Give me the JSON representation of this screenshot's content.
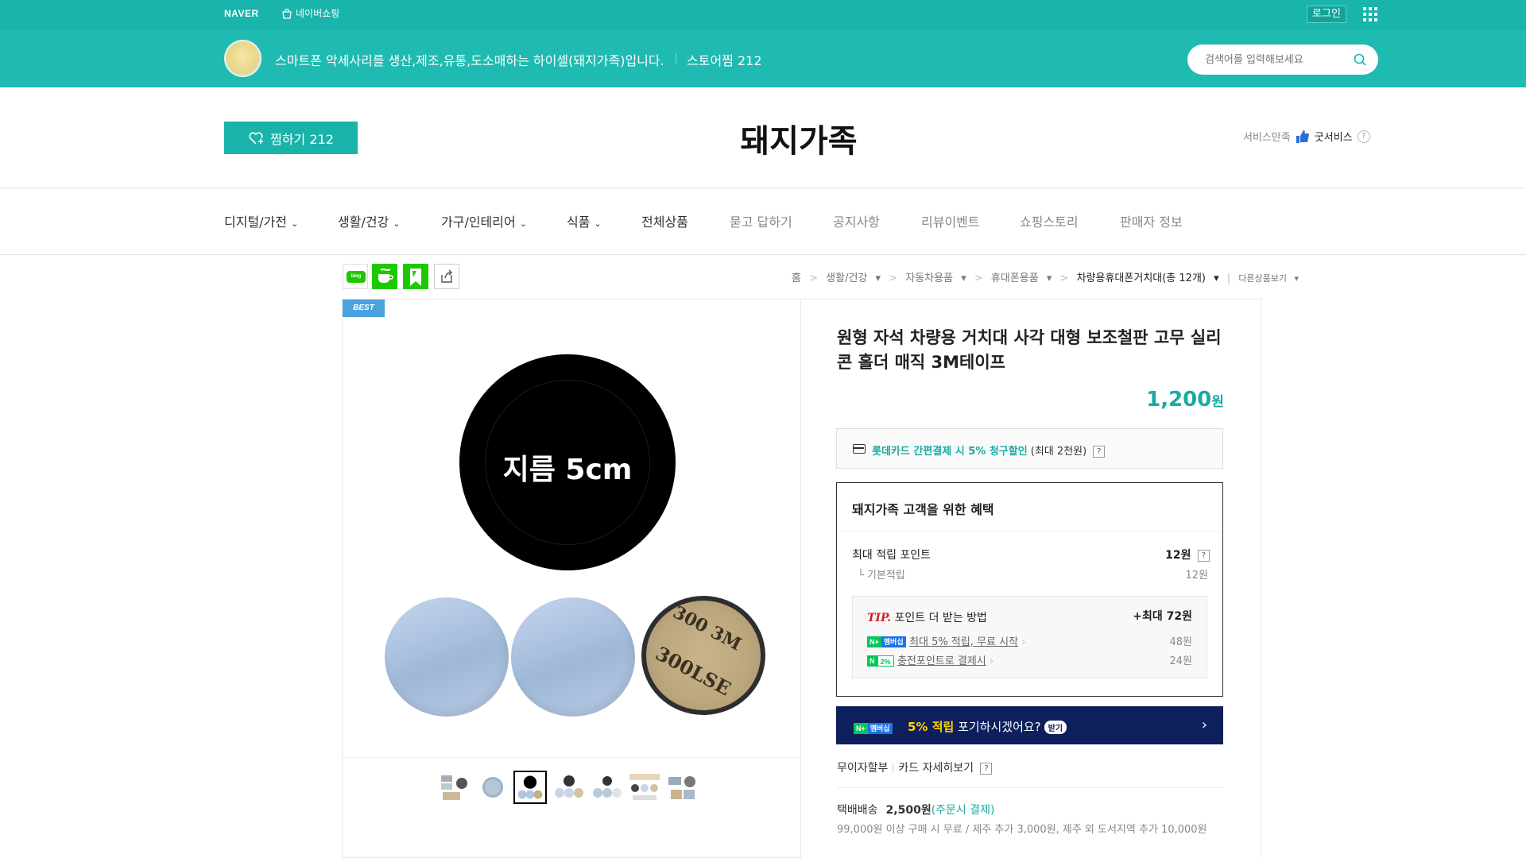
{
  "topbar": {
    "logo": "NAVER",
    "shop": "네이버쇼핑",
    "login": "로그인"
  },
  "store": {
    "description": "스마트폰 악세사리를 생산,제조,유통,도소매하는 하이셀(돼지가족)입니다.",
    "zzim": "스토어찜 212",
    "search_placeholder": "검색어를 입력해보세요"
  },
  "brand": {
    "zzim_button": "찜하기 212",
    "name": "돼지가족",
    "service_label": "서비스만족",
    "service_value": "굿서비스",
    "help": "?"
  },
  "nav": {
    "items": [
      {
        "label": "디지털/가전",
        "caret": "⌄"
      },
      {
        "label": "생활/건강",
        "caret": "⌄"
      },
      {
        "label": "가구/인테리어",
        "caret": "⌄"
      },
      {
        "label": "식품",
        "caret": "⌄"
      },
      {
        "label": "전체상품"
      },
      {
        "label": "묻고 답하기"
      },
      {
        "label": "공지사항"
      },
      {
        "label": "리뷰이벤트"
      },
      {
        "label": "쇼핑스토리"
      },
      {
        "label": "판매자 정보"
      }
    ]
  },
  "share": {
    "blog": "blog"
  },
  "breadcrumb": {
    "home": "홈",
    "c1": "생활/건강",
    "c2": "자동차용품",
    "c3": "휴대폰용품",
    "current": "차량용휴대폰거치대(총 12개)",
    "more": "다른상품보기"
  },
  "gallery": {
    "badge": "BEST",
    "main_label": "지름 5cm",
    "tape_line1": "300",
    "tape_line2": "300LSE",
    "tape_brand": "3M"
  },
  "product": {
    "title": "원형 자석 차량용 거치대 사각 대형 보조철판 고무 실리콘 홀더 매직 3M테이프",
    "price": "1,200",
    "price_unit": "원",
    "card_promo": "롯데카드 간편결제 시 5% 청구할인",
    "card_note": "(최대 2천원)",
    "q": "?"
  },
  "benefit": {
    "title": "돼지가족 고객을 위한 혜택",
    "max_point_label": "최대 적립 포인트",
    "max_point_value": "12원",
    "base_label": "기본적립",
    "base_value": "12원",
    "tip": "TIP.",
    "tip_label": "포인트 더 받는 방법",
    "tip_max": "+최대 72원",
    "row1_badge": "멤버십",
    "row1_text": "최대 5% 적립, 무료 시작",
    "row1_value": "48원",
    "row2_badge": "2%",
    "row2_text": "충전포인트로 결제시",
    "row2_value": "24원"
  },
  "membership": {
    "badge": "멤버십",
    "highlight": "5% 적립",
    "text": " 포기하시겠어요?",
    "get": "받기",
    "arrow": "›"
  },
  "installment": {
    "label": "무이자할부",
    "card": "카드 자세히보기"
  },
  "shipping": {
    "label": "택배배송",
    "price": "2,500원",
    "pay": "(주문시 결제)",
    "note": "99,000원 이상 구매 시 무료 / 제주 추가 3,000원, 제주 외 도서지역 추가 10,000원"
  },
  "colors": {
    "accent": "#19b4ab",
    "navy": "#0d1f5c",
    "tip_red": "#d71d1d"
  }
}
